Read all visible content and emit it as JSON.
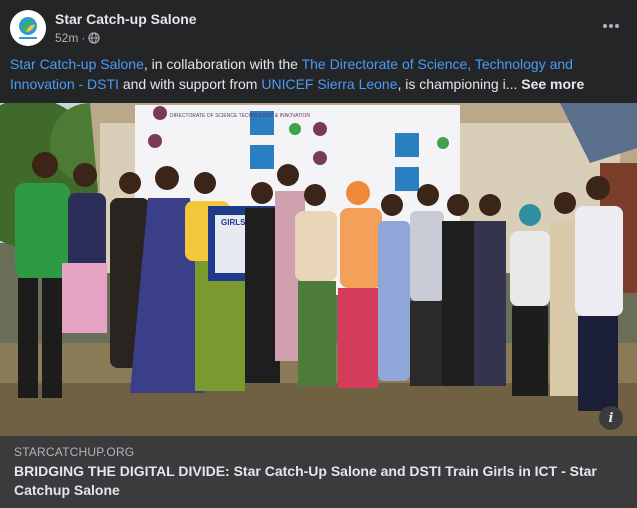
{
  "post": {
    "page_name": "Star Catch-up Salone",
    "time": "52m",
    "separator": "·",
    "privacy_icon": "globe-icon",
    "more_icon": "more-horizontal-icon",
    "caption": {
      "link1": "Star Catch-up Salone",
      "text1": ", in collaboration with the ",
      "link2": "The Directorate of Science, Technology and Innovation - DSTI",
      "text2": " and with support from ",
      "link3": "UNICEF Sierra Leone",
      "text3": ", is championing i... ",
      "see_more": "See more"
    },
    "photo": {
      "banner_text": "DIRECTORATE OF SCIENCE TECHNOLOGY & INNOVATION",
      "sign_text": "GIRLS IN ICT"
    },
    "link_preview": {
      "domain": "STARCATCHUP.ORG",
      "title": "BRIDGING THE DIGITAL DIVIDE: Star Catch-Up Salone and DSTI Train Girls in ICT - Star Catchup Salone",
      "info_icon": "info-icon"
    }
  },
  "colors": {
    "background": "#242526",
    "link": "#4b9af8",
    "preview_bg": "#3a3b3c",
    "muted_text": "#b0b3b8"
  }
}
